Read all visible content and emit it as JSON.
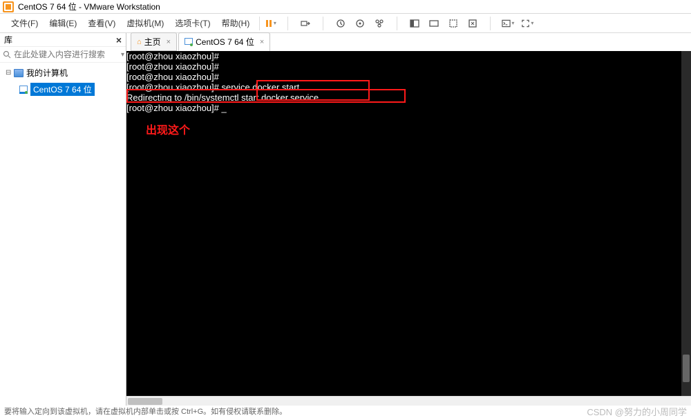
{
  "titlebar": {
    "title": "CentOS 7 64 位 - VMware Workstation"
  },
  "menu": {
    "file": "文件(F)",
    "edit": "编辑(E)",
    "view": "查看(V)",
    "vm": "虚拟机(M)",
    "tabs": "选项卡(T)",
    "help": "帮助(H)"
  },
  "sidebar": {
    "title": "库",
    "search_placeholder": "在此处键入内容进行搜索",
    "my_computer": "我的计算机",
    "vm_name": "CentOS 7 64 位"
  },
  "tabs": {
    "home": "主页",
    "vm": "CentOS 7 64 位"
  },
  "terminal": {
    "lines": [
      "[root@zhou xiaozhou]#",
      "[root@zhou xiaozhou]#",
      "[root@zhou xiaozhou]#",
      "[root@zhou xiaozhou]# service docker start",
      "Redirecting to /bin/systemctl start docker.service",
      "[root@zhou xiaozhou]# _"
    ],
    "annotation": "出现这个"
  },
  "statusbar": {
    "text": "要将输入定向到该虚拟机，请在虚拟机内部单击或按 Ctrl+G。如有侵权请联系删除。"
  },
  "watermark": "CSDN @努力的小周同学"
}
